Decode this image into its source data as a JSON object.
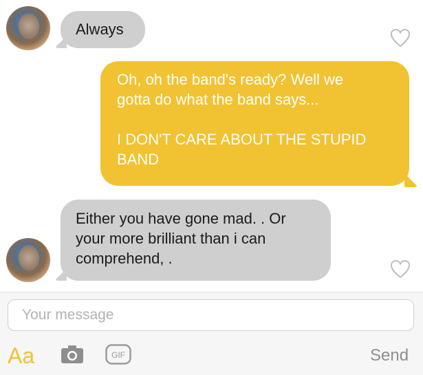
{
  "messages": [
    {
      "direction": "incoming",
      "text": "Always",
      "liked": false
    },
    {
      "direction": "outgoing",
      "text_lines": [
        "Oh, oh the band's ready? Well we",
        "gotta do what the band says...",
        "",
        "I DON'T CARE ABOUT THE STUPID",
        "BAND"
      ]
    },
    {
      "direction": "incoming",
      "text_lines": [
        "Either you have gone mad. . Or",
        "your more brilliant than i can",
        "comprehend, ."
      ],
      "liked": false
    }
  ],
  "composer": {
    "placeholder": "Your message",
    "format_label": "Aa",
    "gif_label": "GIF",
    "send_label": "Send"
  },
  "icons": {
    "like": "heart-outline-icon",
    "camera": "camera-icon",
    "gif": "gif-icon"
  },
  "colors": {
    "incoming_bubble": "#cfcfcf",
    "outgoing_bubble": "#f1c232",
    "accent": "#f1c232",
    "send_text": "#8e8e8e"
  }
}
